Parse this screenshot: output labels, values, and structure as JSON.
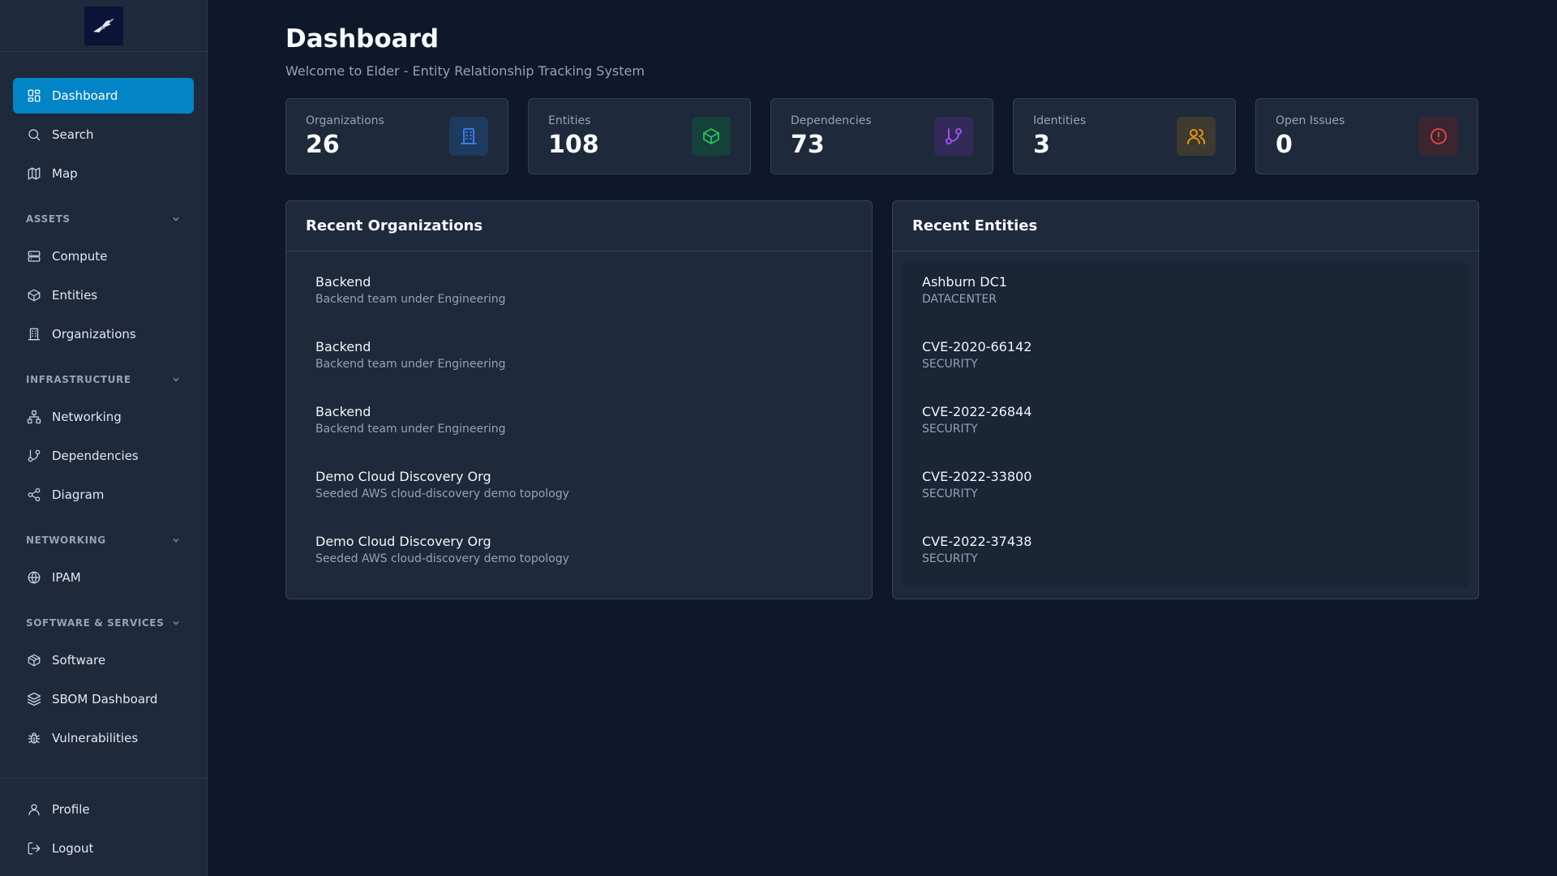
{
  "sidebar": {
    "top_items": [
      {
        "label": "Dashboard",
        "icon": "dashboard-icon",
        "active": true
      },
      {
        "label": "Search",
        "icon": "search-icon"
      },
      {
        "label": "Map",
        "icon": "map-icon"
      }
    ],
    "sections": [
      {
        "title": "ASSETS",
        "items": [
          {
            "label": "Compute",
            "icon": "server-icon"
          },
          {
            "label": "Entities",
            "icon": "box-icon"
          },
          {
            "label": "Organizations",
            "icon": "building-icon"
          }
        ]
      },
      {
        "title": "INFRASTRUCTURE",
        "items": [
          {
            "label": "Networking",
            "icon": "network-icon"
          },
          {
            "label": "Dependencies",
            "icon": "git-branch-icon"
          },
          {
            "label": "Diagram",
            "icon": "share-icon"
          }
        ]
      },
      {
        "title": "NETWORKING",
        "items": [
          {
            "label": "IPAM",
            "icon": "globe-icon"
          }
        ]
      },
      {
        "title": "SOFTWARE & SERVICES",
        "items": [
          {
            "label": "Software",
            "icon": "package-icon"
          },
          {
            "label": "SBOM Dashboard",
            "icon": "layers-icon"
          },
          {
            "label": "Vulnerabilities",
            "icon": "bug-icon"
          }
        ]
      }
    ],
    "bottom_items": [
      {
        "label": "Profile",
        "icon": "user-icon"
      },
      {
        "label": "Logout",
        "icon": "logout-icon"
      }
    ]
  },
  "page": {
    "title": "Dashboard",
    "subtitle": "Welcome to Elder - Entity Relationship Tracking System"
  },
  "stats": [
    {
      "label": "Organizations",
      "value": "26",
      "icon": "building-icon",
      "color": "#3b82f6",
      "bg": "#1e3a5f"
    },
    {
      "label": "Entities",
      "value": "108",
      "icon": "box-icon",
      "color": "#22c55e",
      "bg": "#16403a"
    },
    {
      "label": "Dependencies",
      "value": "73",
      "icon": "git-branch-icon",
      "color": "#a855f7",
      "bg": "#332a5a"
    },
    {
      "label": "Identities",
      "value": "3",
      "icon": "users-icon",
      "color": "#f59e0b",
      "bg": "#3d3a2f"
    },
    {
      "label": "Open Issues",
      "value": "0",
      "icon": "alert-circle-icon",
      "color": "#ef4444",
      "bg": "#3b2530"
    }
  ],
  "recent_organizations": {
    "title": "Recent Organizations",
    "items": [
      {
        "name": "Backend",
        "description": "Backend team under Engineering"
      },
      {
        "name": "Backend",
        "description": "Backend team under Engineering"
      },
      {
        "name": "Backend",
        "description": "Backend team under Engineering"
      },
      {
        "name": "Demo Cloud Discovery Org",
        "description": "Seeded AWS cloud-discovery demo topology"
      },
      {
        "name": "Demo Cloud Discovery Org",
        "description": "Seeded AWS cloud-discovery demo topology"
      }
    ]
  },
  "recent_entities": {
    "title": "Recent Entities",
    "items": [
      {
        "name": "Ashburn DC1",
        "type": "DATACENTER"
      },
      {
        "name": "CVE-2020-66142",
        "type": "SECURITY"
      },
      {
        "name": "CVE-2022-26844",
        "type": "SECURITY"
      },
      {
        "name": "CVE-2022-33800",
        "type": "SECURITY"
      },
      {
        "name": "CVE-2022-37438",
        "type": "SECURITY"
      }
    ]
  }
}
